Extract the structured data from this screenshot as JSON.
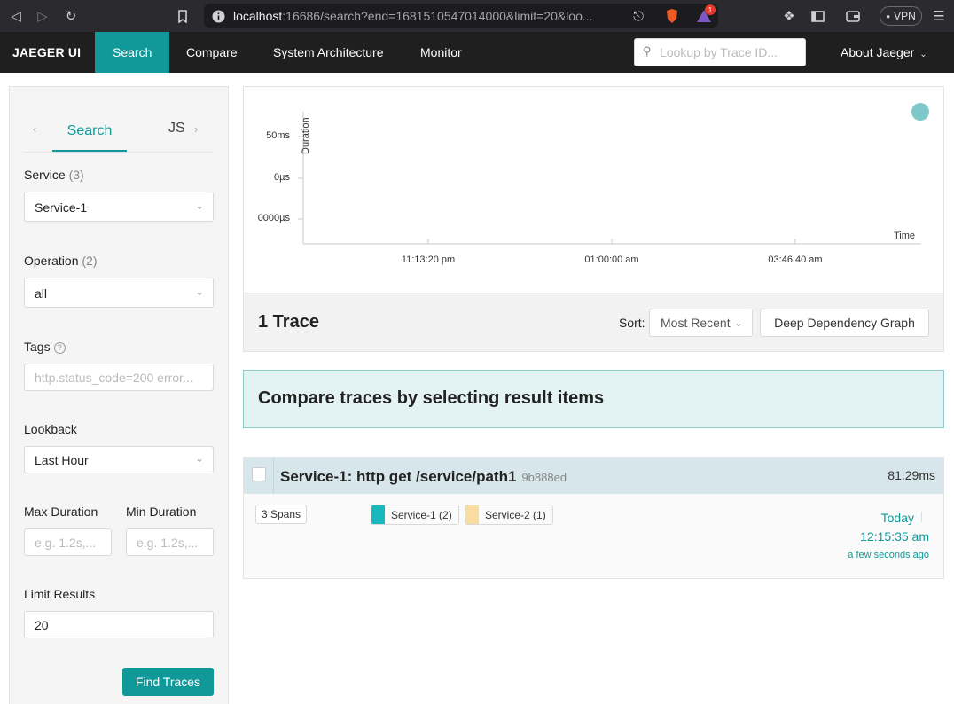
{
  "browser": {
    "url_host": "localhost",
    "url_rest": ":16686/search?end=1681510547014000&limit=20&loo...",
    "notification_count": "1",
    "vpn_label": "VPN"
  },
  "nav": {
    "brand": "JAEGER UI",
    "items": [
      {
        "label": "Search",
        "active": true
      },
      {
        "label": "Compare",
        "active": false
      },
      {
        "label": "System Architecture",
        "active": false
      },
      {
        "label": "Monitor",
        "active": false
      }
    ],
    "lookup_placeholder": "Lookup by Trace ID...",
    "about": "About Jaeger"
  },
  "sidebar": {
    "tabs": {
      "search": "Search",
      "js": "JS"
    },
    "service": {
      "label": "Service",
      "count": "(3)",
      "value": "Service-1"
    },
    "operation": {
      "label": "Operation",
      "count": "(2)",
      "value": "all"
    },
    "tags": {
      "label": "Tags",
      "placeholder": "http.status_code=200 error..."
    },
    "lookback": {
      "label": "Lookback",
      "value": "Last Hour"
    },
    "max_duration": {
      "label": "Max Duration",
      "placeholder": "e.g. 1.2s,..."
    },
    "min_duration": {
      "label": "Min Duration",
      "placeholder": "e.g. 1.2s,..."
    },
    "limit": {
      "label": "Limit Results",
      "value": "20"
    },
    "find_button": "Find Traces"
  },
  "plot": {
    "y_ticks": [
      "50ms",
      "0µs",
      "0000µs"
    ],
    "x_ticks": [
      "11:13:20 pm",
      "01:00:00 am",
      "03:46:40 am"
    ],
    "y_label": "Duration",
    "x_label": "Time",
    "point_color": "#7ec8ca"
  },
  "results": {
    "count": "1 Trace",
    "sort_label": "Sort:",
    "sort_value": "Most Recent",
    "ddg_button": "Deep Dependency Graph"
  },
  "compare_banner": "Compare traces by selecting result items",
  "trace": {
    "title": "Service-1: http get /service/path1",
    "id": "9b888ed",
    "duration": "81.29ms",
    "spans": "3 Spans",
    "services": [
      {
        "label": "Service-1 (2)",
        "color": "#17b8be"
      },
      {
        "label": "Service-2 (1)",
        "color": "#f8dca1"
      }
    ],
    "day": "Today",
    "time": "12:15:35 am",
    "relative": "a few seconds ago"
  },
  "colors": {
    "accent": "#119999",
    "nav_bg": "#1f1f1f"
  }
}
